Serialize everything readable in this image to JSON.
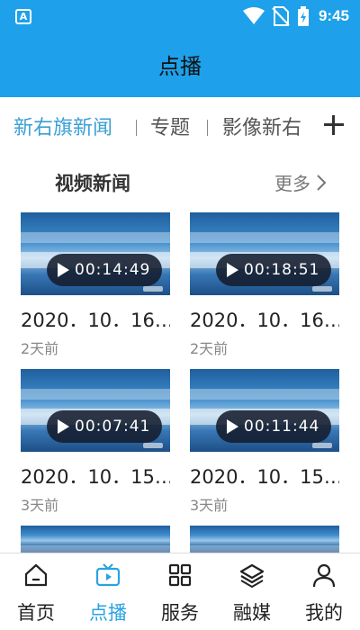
{
  "status_bar": {
    "left_icon": "A",
    "time": "9:45",
    "icons": [
      "wifi-icon",
      "no-sim-icon",
      "battery-icon"
    ]
  },
  "header": {
    "title": "点播"
  },
  "tabs": [
    {
      "label": "新右旗新闻",
      "active": true
    },
    {
      "label": "专题",
      "active": false
    },
    {
      "label": "影像新右",
      "active": false
    }
  ],
  "section": {
    "title": "视频新闻",
    "more_label": "更多"
  },
  "videos": [
    {
      "duration": "00:14:49",
      "title": "2020．10．16…",
      "time_ago": "2天前"
    },
    {
      "duration": "00:18:51",
      "title": "2020．10．16…",
      "time_ago": "2天前"
    },
    {
      "duration": "00:07:41",
      "title": "2020．10．15…",
      "time_ago": "3天前"
    },
    {
      "duration": "00:11:44",
      "title": "2020．10．15…",
      "time_ago": "3天前"
    }
  ],
  "bottom_nav": [
    {
      "label": "首页",
      "icon": "home-icon",
      "active": false
    },
    {
      "label": "点播",
      "icon": "tv-icon",
      "active": true
    },
    {
      "label": "服务",
      "icon": "grid-icon",
      "active": false
    },
    {
      "label": "融媒",
      "icon": "layers-icon",
      "active": false
    },
    {
      "label": "我的",
      "icon": "person-icon",
      "active": false
    }
  ],
  "colors": {
    "header": "#1ea1ea",
    "accent": "#2ba2e2",
    "tab_active": "#3aa0d5"
  }
}
